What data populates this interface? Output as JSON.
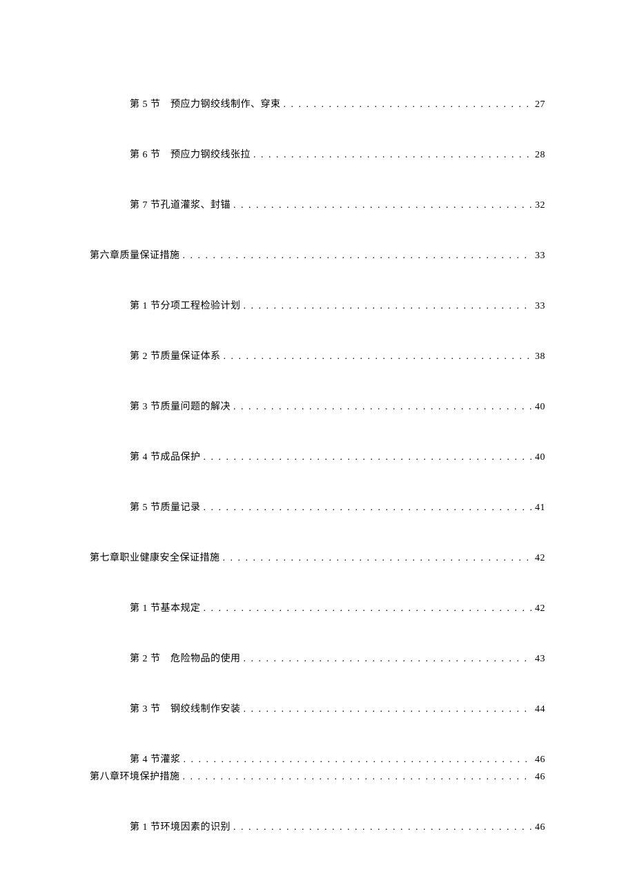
{
  "entries": [
    {
      "indent": 1,
      "label": "第 5 节　预应力钢绞线制作、穿束",
      "page": "27",
      "tight": false
    },
    {
      "indent": 1,
      "label": "第 6 节　预应力钢绞线张拉",
      "page": "28",
      "tight": false
    },
    {
      "indent": 1,
      "label": "第 7 节孔道灌浆、封锚",
      "page": "32",
      "tight": false
    },
    {
      "indent": 0,
      "label": "第六章质量保证措施",
      "page": "33",
      "tight": false
    },
    {
      "indent": 1,
      "label": "第 1 节分项工程检验计划",
      "page": "33",
      "tight": false
    },
    {
      "indent": 1,
      "label": "第 2 节质量保证体系",
      "page": "38",
      "tight": false
    },
    {
      "indent": 1,
      "label": "第 3 节质量问题的解决",
      "page": "40",
      "tight": false
    },
    {
      "indent": 1,
      "label": "第 4 节成品保护",
      "page": "40",
      "tight": false
    },
    {
      "indent": 1,
      "label": "第 5 节质量记录",
      "page": "41",
      "tight": false
    },
    {
      "indent": 0,
      "label": "第七章职业健康安全保证措施",
      "page": "42",
      "tight": false
    },
    {
      "indent": 1,
      "label": "第 1 节基本规定",
      "page": "42",
      "tight": false
    },
    {
      "indent": 1,
      "label": "第 2 节　危险物品的使用",
      "page": "43",
      "tight": false
    },
    {
      "indent": 1,
      "label": "第 3 节　钢绞线制作安装",
      "page": "44",
      "tight": false
    },
    {
      "indent": 1,
      "label": "第 4 节灌浆",
      "page": "46",
      "tight": true
    },
    {
      "indent": 0,
      "label": "第八章环境保护措施",
      "page": "46",
      "tight": false
    },
    {
      "indent": 1,
      "label": "第 1 节环境因素的识别",
      "page": "46",
      "tight": false
    }
  ]
}
